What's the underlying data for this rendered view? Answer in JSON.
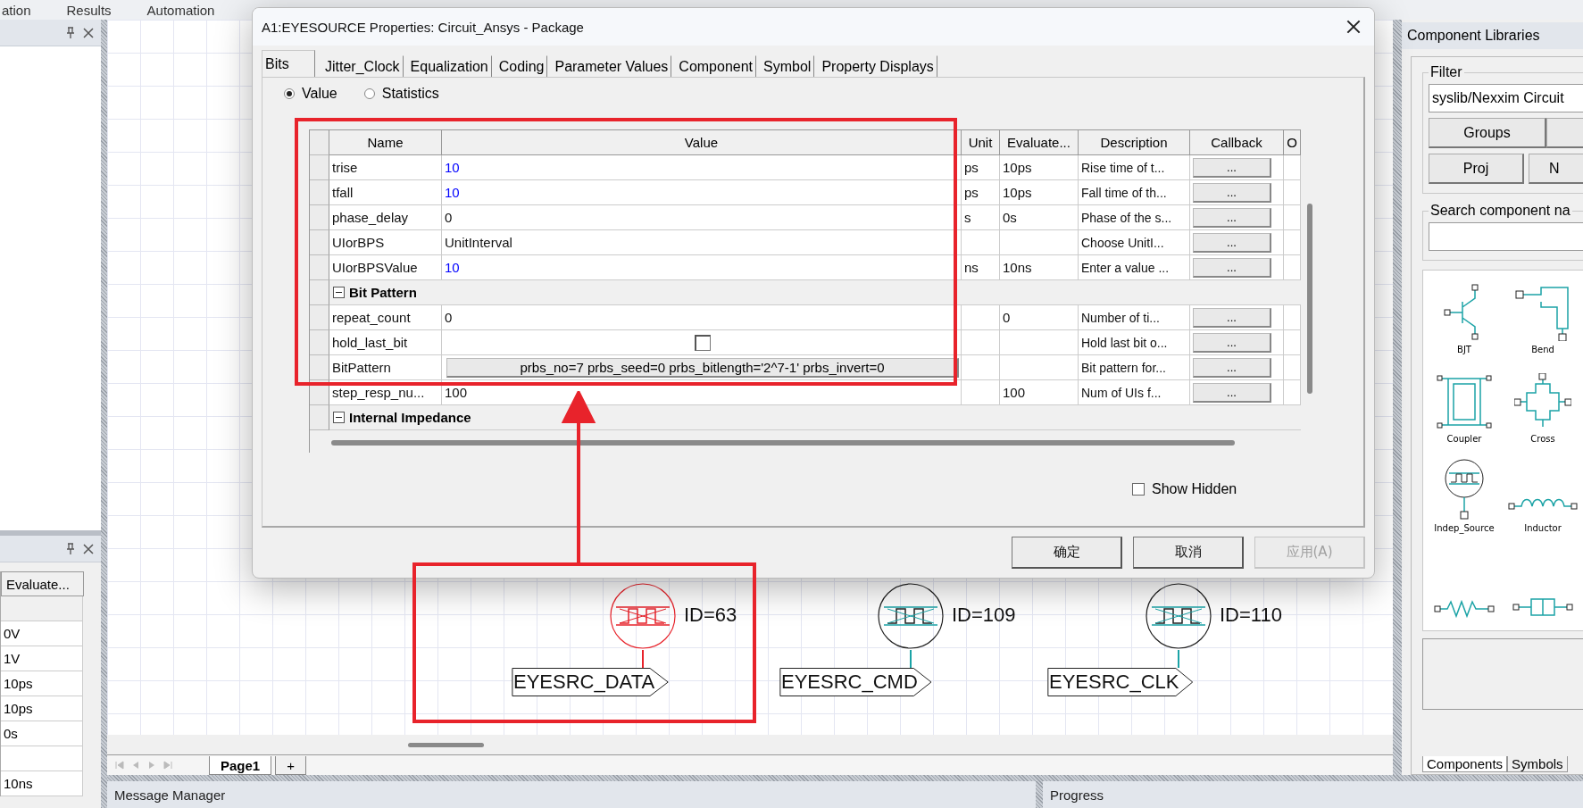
{
  "menu": [
    "ation",
    "Results",
    "Automation"
  ],
  "left_bottom_table": {
    "column": "Evaluate...",
    "rows": [
      {
        "kind": "blank"
      },
      {
        "kind": "value",
        "value": "0V"
      },
      {
        "kind": "value",
        "value": "1V"
      },
      {
        "kind": "value",
        "value": "10ps"
      },
      {
        "kind": "value",
        "value": "10ps"
      },
      {
        "kind": "value",
        "value": "0s"
      },
      {
        "kind": "blank"
      },
      {
        "kind": "value",
        "value": "10ns"
      }
    ]
  },
  "canvas": {
    "parts": [
      {
        "id_label": "ID=63",
        "port": "EYESRC_DATA",
        "selected": true
      },
      {
        "id_label": "ID=109",
        "port": "EYESRC_CMD",
        "selected": false
      },
      {
        "id_label": "ID=110",
        "port": "EYESRC_CLK",
        "selected": false
      }
    ],
    "page_tabs": [
      {
        "label": "Page1",
        "selected": true
      },
      {
        "label": "+",
        "selected": false
      }
    ]
  },
  "dialog": {
    "title": "A1:EYESOURCE Properties: Circuit_Ansys - Package",
    "tabs": [
      {
        "label": "Bits",
        "selected": true
      },
      {
        "label": "Jitter_Clock",
        "selected": false
      },
      {
        "label": "Equalization",
        "selected": false
      },
      {
        "label": "Coding",
        "selected": false
      },
      {
        "label": "Parameter Values",
        "selected": false
      },
      {
        "label": "Component",
        "selected": false
      },
      {
        "label": "Symbol",
        "selected": false
      },
      {
        "label": "Property Displays",
        "selected": false
      }
    ],
    "radios": [
      {
        "label": "Value",
        "selected": true
      },
      {
        "label": "Statistics",
        "selected": false
      }
    ],
    "columns": [
      "Name",
      "Value",
      "Unit",
      "Evaluate...",
      "Description",
      "Callback",
      "O"
    ],
    "rows": [
      {
        "kind": "param",
        "name": "trise",
        "value": "10",
        "modified": true,
        "unit": "ps",
        "evaluated": "10ps",
        "description": "Rise time of t...",
        "callback": "..."
      },
      {
        "kind": "param",
        "name": "tfall",
        "value": "10",
        "modified": true,
        "unit": "ps",
        "evaluated": "10ps",
        "description": "Fall time of th...",
        "callback": "..."
      },
      {
        "kind": "param",
        "name": "phase_delay",
        "value": "0",
        "modified": false,
        "unit": "s",
        "evaluated": "0s",
        "description": "Phase of the s...",
        "callback": "..."
      },
      {
        "kind": "param",
        "name": "UIorBPS",
        "value": "UnitInterval",
        "modified": false,
        "description": "Choose UnitI...",
        "callback": "..."
      },
      {
        "kind": "param",
        "name": "UIorBPSValue",
        "value": "10",
        "modified": true,
        "unit": "ns",
        "evaluated": "10ns",
        "description": "Enter a value ...",
        "callback": "..."
      },
      {
        "kind": "group",
        "label": "Bit Pattern",
        "expanded": true
      },
      {
        "kind": "param",
        "name": "repeat_count",
        "value": "0",
        "modified": false,
        "evaluated": "0",
        "description": "Number of ti...",
        "callback": "..."
      },
      {
        "kind": "checkbox",
        "name": "hold_last_bit",
        "checked": false,
        "description": "Hold last bit o...",
        "callback": "..."
      },
      {
        "kind": "pattern",
        "name": "BitPattern",
        "value": "prbs_no=7 prbs_seed=0 prbs_bitlength='2^7-1' prbs_invert=0",
        "description": "Bit pattern for...",
        "callback": "..."
      },
      {
        "kind": "param",
        "name": "step_resp_nu...",
        "value": "100",
        "modified": false,
        "evaluated": "100",
        "description": "Num of UIs f...",
        "callback": "..."
      },
      {
        "kind": "group",
        "label": "Internal Impedance",
        "expanded": true
      }
    ],
    "show_hidden": {
      "label": "Show Hidden",
      "checked": false
    },
    "buttons": [
      {
        "label": "确定",
        "disabled": false
      },
      {
        "label": "取消",
        "disabled": false
      },
      {
        "label": "应用(A)",
        "disabled": true
      }
    ]
  },
  "right_panel": {
    "title": "Component Libraries",
    "filter": {
      "legend": "Filter",
      "value": "syslib/Nexxim Circuit",
      "buttons": [
        {
          "kind": "button",
          "label": "Groups"
        },
        {
          "kind": "button"
        },
        {
          "kind": "button",
          "label": "Proj"
        },
        {
          "kind": "button",
          "label": "N"
        }
      ]
    },
    "search": {
      "legend": "Search component na"
    },
    "components": [
      {
        "kind": "bjt",
        "name": "BJT"
      },
      {
        "kind": "bend",
        "name": "Bend"
      },
      {
        "kind": "coupler",
        "name": "Coupler"
      },
      {
        "kind": "cross",
        "name": "Cross"
      },
      {
        "kind": "source",
        "name": "Indep_Source"
      },
      {
        "kind": "inductor",
        "name": "Inductor"
      },
      {
        "kind": "resistor"
      },
      {
        "kind": "twoport"
      }
    ],
    "tabs": [
      {
        "label": "Components",
        "selected": true
      },
      {
        "label": "Symbols",
        "selected": false
      }
    ]
  },
  "bottom": {
    "message_manager": "Message Manager",
    "progress": "Progress"
  }
}
